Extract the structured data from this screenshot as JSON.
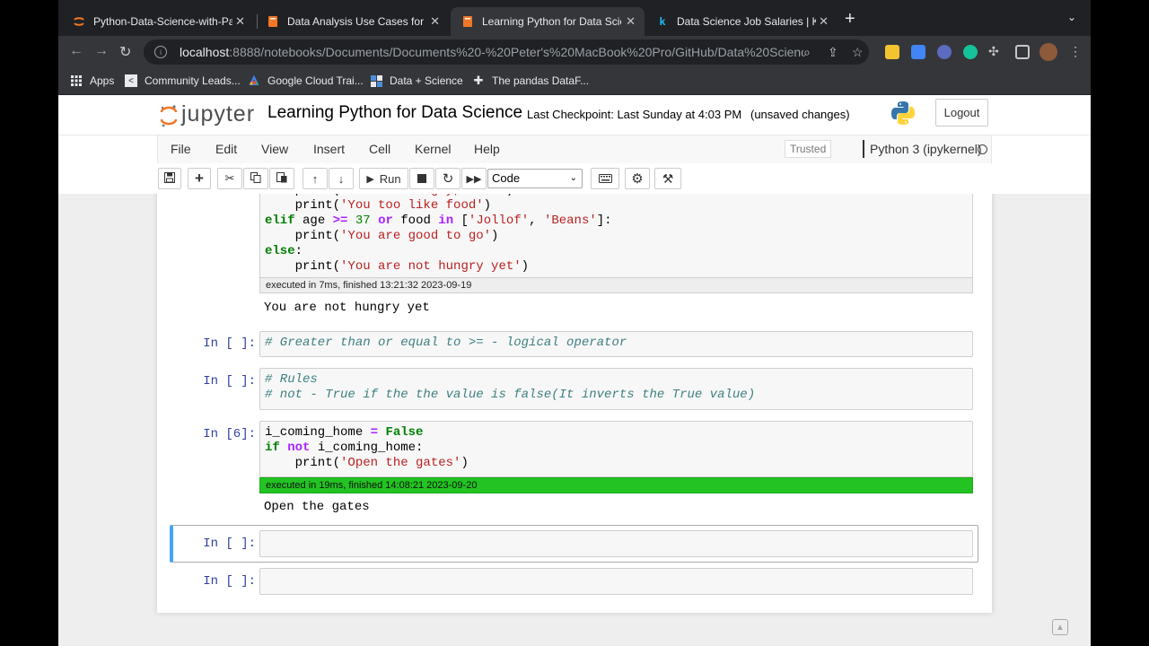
{
  "tabs": [
    {
      "title": "Python-Data-Science-with-Pa",
      "icon": "jupyter-favicon",
      "active": false
    },
    {
      "title": "Data Analysis Use Cases for Py",
      "icon": "notebook-favicon",
      "active": false
    },
    {
      "title": "Learning Python for Data Scien",
      "icon": "notebook-favicon",
      "active": true
    },
    {
      "title": "Data Science Job Salaries | Ka",
      "icon": "kaggle-favicon",
      "active": false
    }
  ],
  "browser": {
    "url_host": "localhost",
    "url_path": ":8888/notebooks/Documents/Documents%20-%20Peter's%20MacBook%20Pro/GitHub/Data%20Science..."
  },
  "bookmarks": [
    {
      "label": "Apps",
      "icon": "apps-grid-icon"
    },
    {
      "label": "Community Leads...",
      "icon": "code-icon"
    },
    {
      "label": "Google Cloud Trai...",
      "icon": "google-cloud-icon"
    },
    {
      "label": "Data + Science",
      "icon": "grid-logo-icon"
    },
    {
      "label": "The pandas DataF...",
      "icon": "pandas-icon"
    }
  ],
  "jupyter": {
    "logo_text": "jupyter",
    "notebook_name": "Learning Python for Data Science",
    "checkpoint": "Last Checkpoint: Last Sunday at 4:03 PM",
    "save_status": "(unsaved changes)",
    "logout_label": "Logout"
  },
  "menu": {
    "items": [
      "File",
      "Edit",
      "View",
      "Insert",
      "Cell",
      "Kernel",
      "Help"
    ],
    "trusted": "Trusted",
    "kernel_name": "Python 3 (ipykernel)"
  },
  "toolbar": {
    "run_label": "Run",
    "cell_type": "Code"
  },
  "cells": {
    "c0": {
      "exec": "executed in 7ms, finished 13:21:32 2023-09-19",
      "output": "You are not hungry yet"
    },
    "c1": {
      "prompt": "In [ ]:"
    },
    "c2": {
      "prompt": "In [ ]:"
    },
    "c3": {
      "prompt": "In [6]:",
      "exec": "executed in 19ms, finished 14:08:21 2023-09-20",
      "output": "Open the gates"
    },
    "c4": {
      "prompt": "In [ ]:"
    },
    "c5": {
      "prompt": "In [ ]:"
    }
  },
  "colors": {
    "exec_success": "#22c322",
    "selected_border": "#42a5f5",
    "prompt": "#303f9f"
  }
}
